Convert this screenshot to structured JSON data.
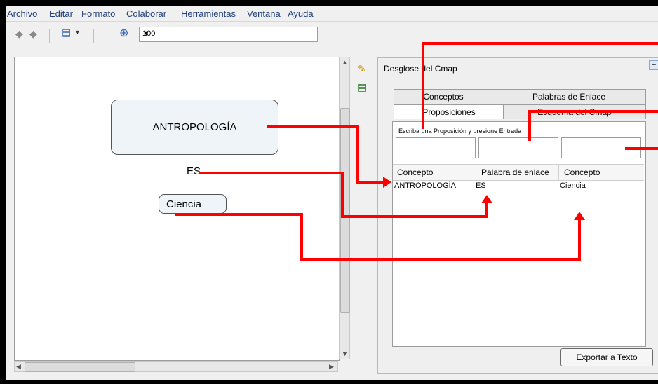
{
  "menu": [
    "Archivo",
    "Editar",
    "Formato",
    "Colaborar",
    "Herramientas",
    "Ventana",
    "Ayuda"
  ],
  "toolbar": {
    "zoom_value": "100"
  },
  "map": {
    "main_concept": "ANTROPOLOGÍA",
    "linking_phrase": "ES",
    "sub_concept": "Ciencia"
  },
  "panel": {
    "title": "Desglose del Cmap",
    "tabs_top": [
      "Conceptos",
      "Palabras de Enlace"
    ],
    "tabs_bottom": [
      "Proposiciones",
      "Esquema del Cmap"
    ],
    "prompt": "Escriba una Proposición y presione Entrada",
    "table": {
      "headers": [
        "Concepto",
        "Palabra de enlace",
        "Concepto"
      ],
      "rows": [
        [
          "ANTROPOLOGÍA",
          "ES",
          "Ciencia"
        ]
      ]
    },
    "export_label": "Exportar a Texto"
  },
  "colors": {
    "annotation": "#ff0000",
    "node_fill": "#eef4f7"
  }
}
